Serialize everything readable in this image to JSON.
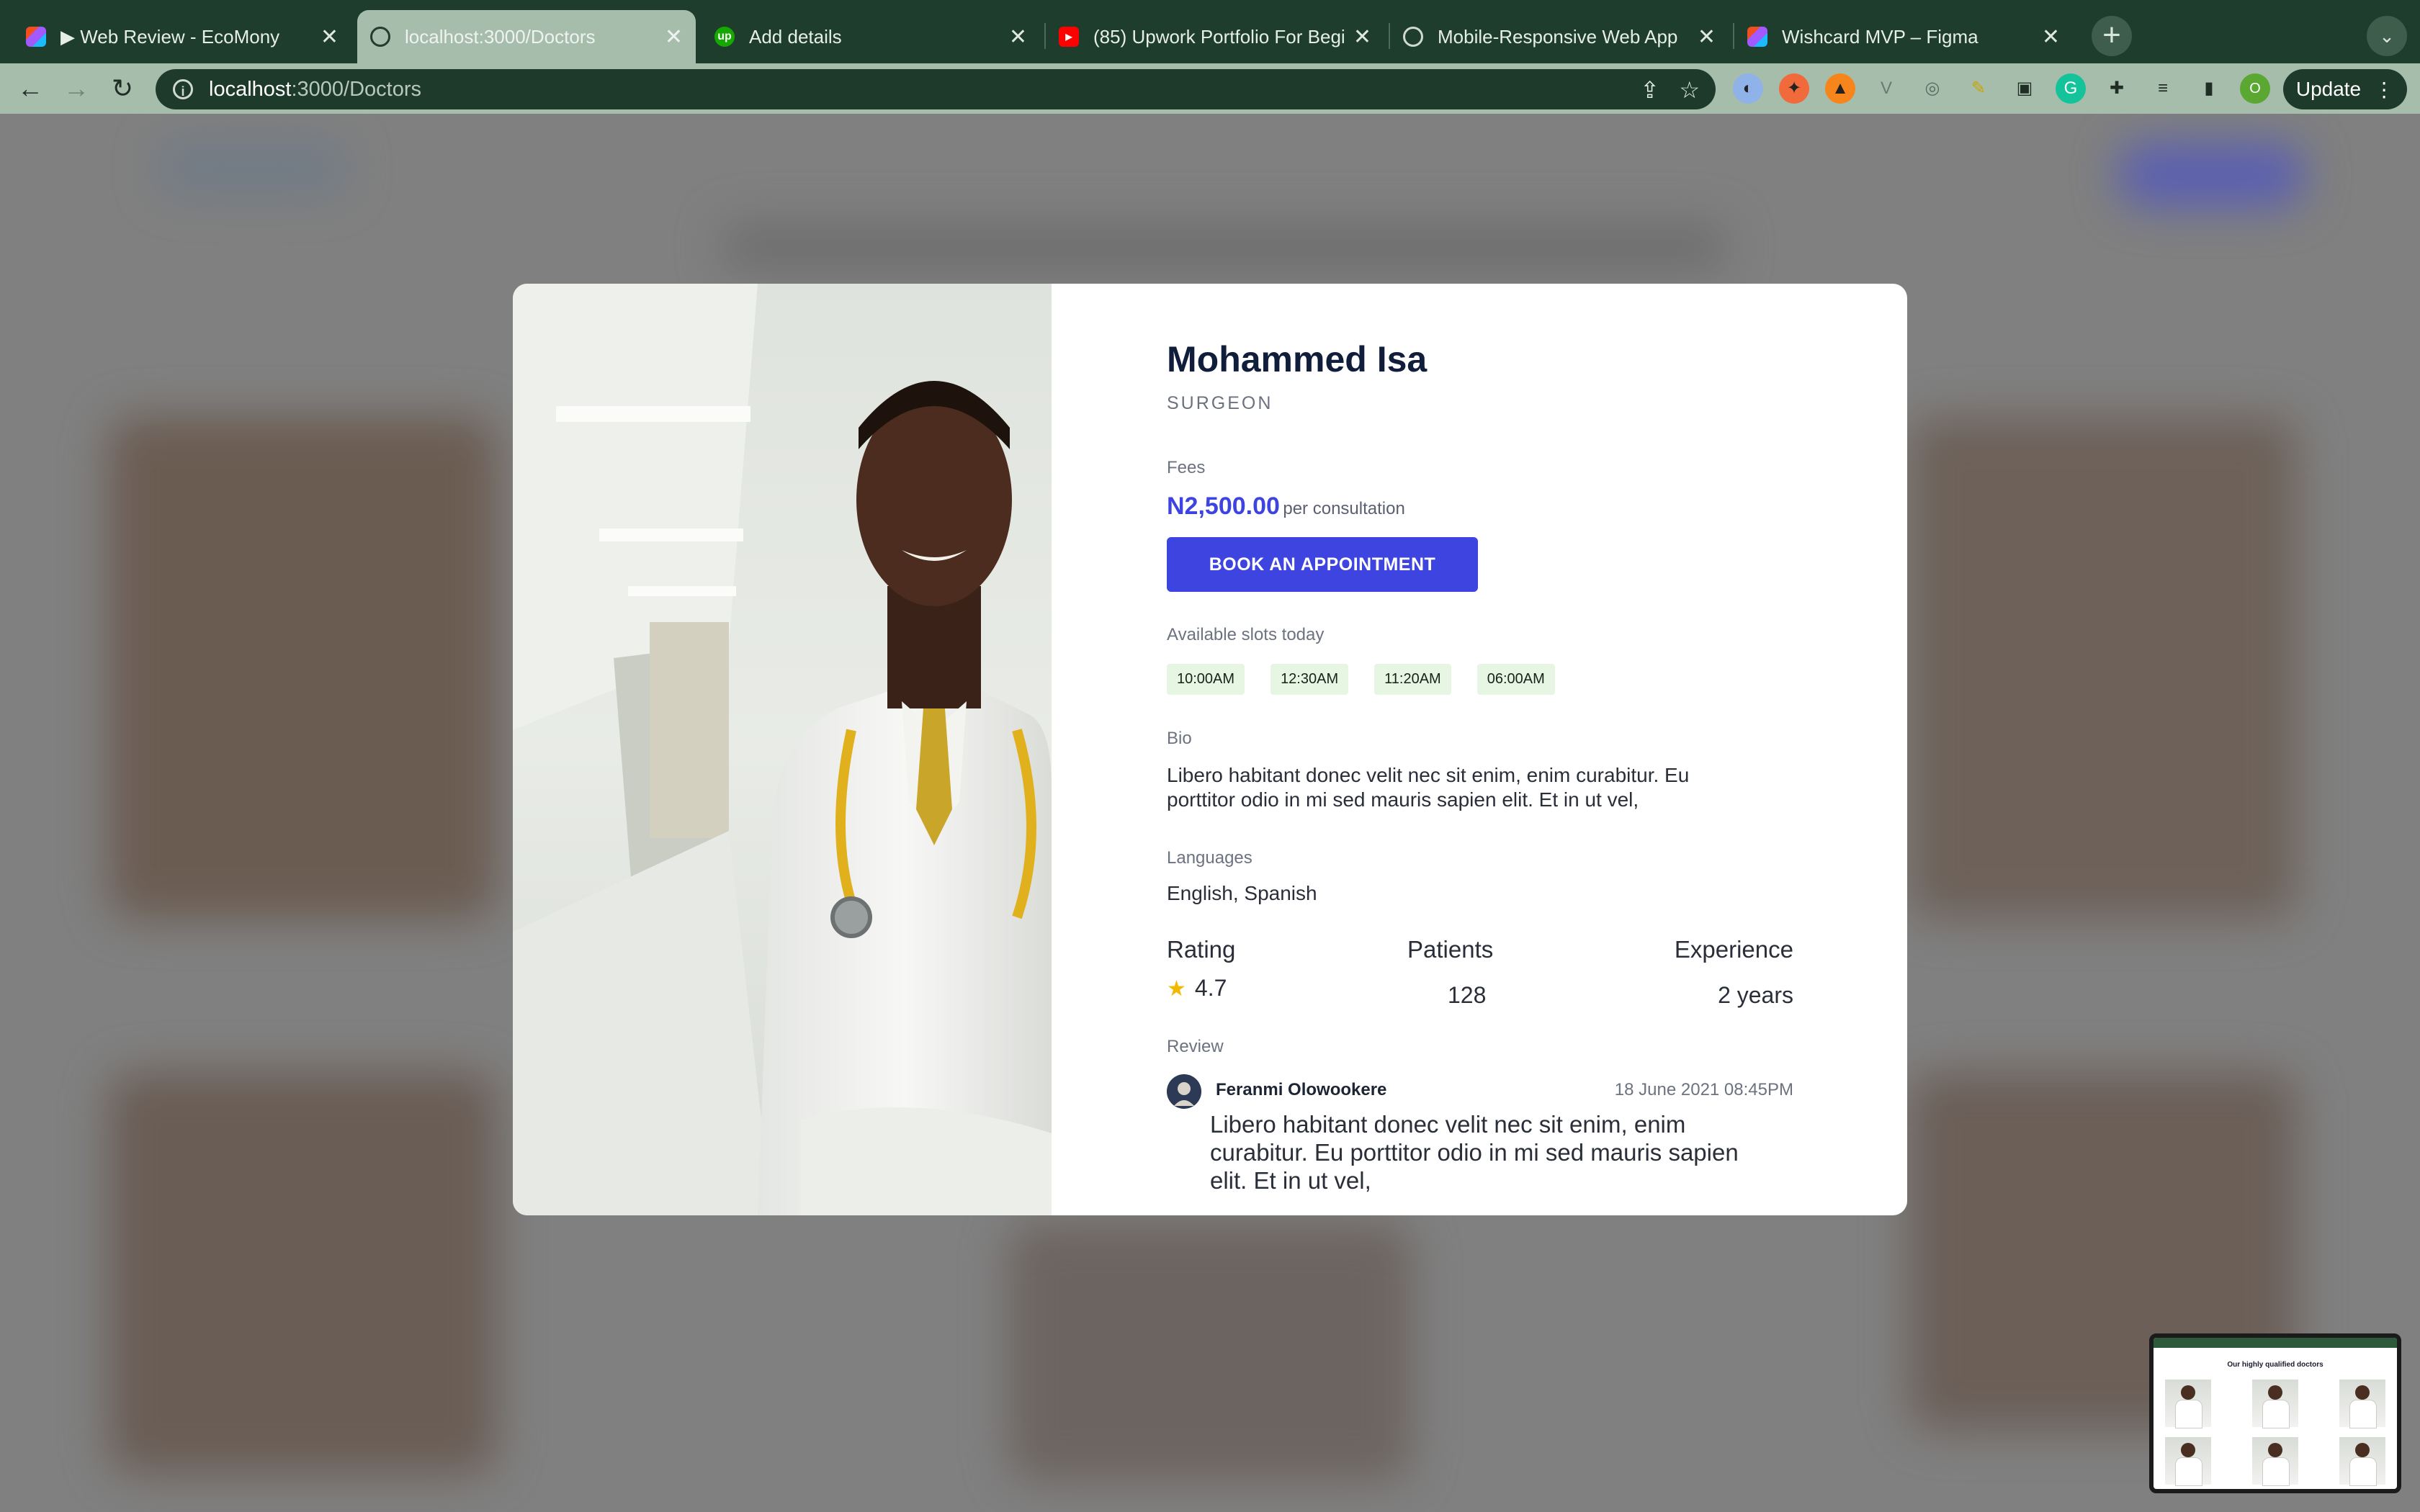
{
  "browser": {
    "tabs": [
      {
        "title": "▶ Web Review - EcoMony",
        "favicon": "figma-icon",
        "active": false
      },
      {
        "title": "localhost:3000/Doctors",
        "favicon": "globe-icon",
        "active": true
      },
      {
        "title": "Add details",
        "favicon": "upwork-icon",
        "active": false
      },
      {
        "title": "(85) Upwork Portfolio For Begi",
        "favicon": "youtube-icon",
        "active": false
      },
      {
        "title": "Mobile-Responsive Web App",
        "favicon": "openai-icon",
        "active": false
      },
      {
        "title": "Wishcard MVP – Figma",
        "favicon": "figma-icon",
        "active": false
      }
    ],
    "address": {
      "host": "localhost",
      "path": ":3000/Doctors"
    },
    "update_label": "Update",
    "profile_initial": "O"
  },
  "doctor": {
    "name": "Mohammed Isa",
    "role": "SURGEON",
    "fees_label": "Fees",
    "fee_amount": "N2,500.00",
    "fee_unit": "per consultation",
    "book_label": "BOOK AN APPOINTMENT",
    "slots_label": "Available slots today",
    "slots": [
      "10:00AM",
      "12:30AM",
      "11:20AM",
      "06:00AM"
    ],
    "bio_label": "Bio",
    "bio": "Libero habitant donec velit nec sit enim, enim curabitur. Eu porttitor odio in mi sed mauris sapien elit. Et in ut vel,",
    "languages_label": "Languages",
    "languages": "English, Spanish",
    "stats": {
      "rating_label": "Rating",
      "rating": "4.7",
      "patients_label": "Patients",
      "patients": "128",
      "experience_label": "Experience",
      "experience": "2 years"
    },
    "review_label": "Review",
    "review": {
      "author": "Feranmi Olowookere",
      "date": "18 June 2021 08:45PM",
      "text": "Libero habitant donec velit nec sit enim, enim curabitur. Eu porttitor odio in mi sed mauris sapien elit. Et in ut vel,"
    }
  },
  "pip": {
    "title": "Our highly qualified doctors"
  },
  "colors": {
    "accent": "#3d44e0",
    "slot_bg": "#e6f6e2",
    "chrome": "#1f3d2c",
    "star": "#f3b800"
  }
}
